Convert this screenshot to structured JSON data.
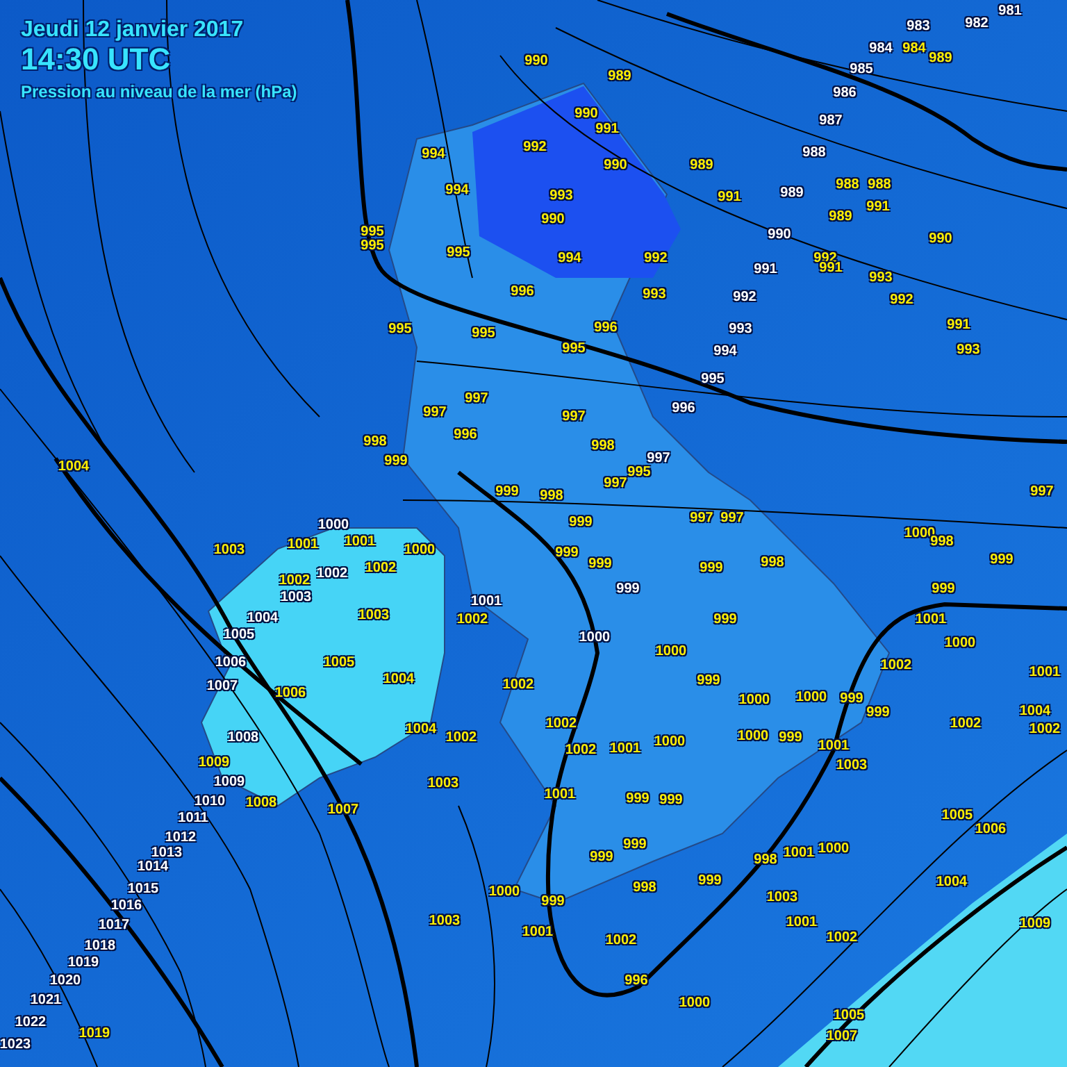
{
  "header": {
    "date": "Jeudi 12 janvier 2017",
    "time": "14:30 UTC",
    "subtitle": "Pression au niveau de la mer (hPa)"
  },
  "labels": [
    {
      "text": "1000",
      "kind": "isobar"
    },
    {
      "text": "1002",
      "kind": "isobar"
    },
    {
      "text": "1003",
      "kind": "isobar"
    },
    {
      "text": "1004",
      "kind": "isobar"
    },
    {
      "text": "1005",
      "kind": "isobar"
    },
    {
      "text": "1006",
      "kind": "isobar"
    },
    {
      "text": "1007",
      "kind": "isobar"
    },
    {
      "text": "1008",
      "kind": "isobar"
    },
    {
      "text": "1009",
      "kind": "isobar"
    },
    {
      "text": "1010",
      "kind": "isobar"
    },
    {
      "text": "1011",
      "kind": "isobar"
    },
    {
      "text": "1012",
      "kind": "isobar"
    },
    {
      "text": "1013",
      "kind": "isobar"
    },
    {
      "text": "1014",
      "kind": "isobar"
    },
    {
      "text": "1015",
      "kind": "isobar"
    },
    {
      "text": "1016",
      "kind": "isobar"
    },
    {
      "text": "1017",
      "kind": "isobar"
    },
    {
      "text": "1018",
      "kind": "isobar"
    },
    {
      "text": "1019",
      "kind": "isobar"
    },
    {
      "text": "1020",
      "kind": "isobar"
    },
    {
      "text": "1021",
      "kind": "isobar"
    },
    {
      "text": "1022",
      "kind": "isobar"
    },
    {
      "text": "1023",
      "kind": "isobar"
    },
    {
      "text": "981",
      "kind": "isobar"
    },
    {
      "text": "982",
      "kind": "isobar"
    },
    {
      "text": "983",
      "kind": "isobar"
    },
    {
      "text": "984",
      "kind": "isobar"
    },
    {
      "text": "985",
      "kind": "isobar"
    },
    {
      "text": "986",
      "kind": "isobar"
    },
    {
      "text": "987",
      "kind": "isobar"
    },
    {
      "text": "988",
      "kind": "isobar"
    },
    {
      "text": "989",
      "kind": "isobar"
    },
    {
      "text": "990",
      "kind": "isobar"
    },
    {
      "text": "991",
      "kind": "isobar"
    },
    {
      "text": "992",
      "kind": "isobar"
    },
    {
      "text": "993",
      "kind": "isobar"
    },
    {
      "text": "994",
      "kind": "isobar"
    },
    {
      "text": "995",
      "kind": "isobar"
    },
    {
      "text": "996",
      "kind": "isobar"
    },
    {
      "text": "997",
      "kind": "isobar"
    },
    {
      "text": "1001",
      "kind": "isobar"
    },
    {
      "text": "1000",
      "kind": "isobar"
    },
    {
      "text": "999",
      "kind": "isobar"
    },
    {
      "text": "990",
      "kind": "station"
    },
    {
      "text": "989",
      "kind": "station"
    },
    {
      "text": "990",
      "kind": "station"
    },
    {
      "text": "991",
      "kind": "station"
    },
    {
      "text": "992",
      "kind": "station"
    },
    {
      "text": "990",
      "kind": "station"
    },
    {
      "text": "994",
      "kind": "station"
    },
    {
      "text": "994",
      "kind": "station"
    },
    {
      "text": "993",
      "kind": "station"
    },
    {
      "text": "990",
      "kind": "station"
    },
    {
      "text": "994",
      "kind": "station"
    },
    {
      "text": "992",
      "kind": "station"
    },
    {
      "text": "996",
      "kind": "station"
    },
    {
      "text": "993",
      "kind": "station"
    },
    {
      "text": "995",
      "kind": "station"
    },
    {
      "text": "995",
      "kind": "station"
    },
    {
      "text": "995",
      "kind": "station"
    },
    {
      "text": "995",
      "kind": "station"
    },
    {
      "text": "995",
      "kind": "station"
    },
    {
      "text": "996",
      "kind": "station"
    },
    {
      "text": "995",
      "kind": "station"
    },
    {
      "text": "997",
      "kind": "station"
    },
    {
      "text": "997",
      "kind": "station"
    },
    {
      "text": "996",
      "kind": "station"
    },
    {
      "text": "997",
      "kind": "station"
    },
    {
      "text": "998",
      "kind": "station"
    },
    {
      "text": "998",
      "kind": "station"
    },
    {
      "text": "999",
      "kind": "station"
    },
    {
      "text": "989",
      "kind": "station"
    },
    {
      "text": "991",
      "kind": "station"
    },
    {
      "text": "988",
      "kind": "station"
    },
    {
      "text": "988",
      "kind": "station"
    },
    {
      "text": "991",
      "kind": "station"
    },
    {
      "text": "989",
      "kind": "station"
    },
    {
      "text": "992",
      "kind": "station"
    },
    {
      "text": "991",
      "kind": "station"
    },
    {
      "text": "993",
      "kind": "station"
    },
    {
      "text": "992",
      "kind": "station"
    },
    {
      "text": "993",
      "kind": "station"
    },
    {
      "text": "991",
      "kind": "station"
    },
    {
      "text": "990",
      "kind": "station"
    },
    {
      "text": "984",
      "kind": "station"
    },
    {
      "text": "989",
      "kind": "station"
    },
    {
      "text": "999",
      "kind": "station"
    },
    {
      "text": "998",
      "kind": "station"
    },
    {
      "text": "997",
      "kind": "station"
    },
    {
      "text": "995",
      "kind": "station"
    },
    {
      "text": "999",
      "kind": "station"
    },
    {
      "text": "999",
      "kind": "station"
    },
    {
      "text": "999",
      "kind": "station"
    },
    {
      "text": "997",
      "kind": "station"
    },
    {
      "text": "997",
      "kind": "station"
    },
    {
      "text": "999",
      "kind": "station"
    },
    {
      "text": "998",
      "kind": "station"
    },
    {
      "text": "999",
      "kind": "station"
    },
    {
      "text": "1000",
      "kind": "station"
    },
    {
      "text": "999",
      "kind": "station"
    },
    {
      "text": "1002",
      "kind": "station"
    },
    {
      "text": "1002",
      "kind": "station"
    },
    {
      "text": "1002",
      "kind": "station"
    },
    {
      "text": "1001",
      "kind": "station"
    },
    {
      "text": "1000",
      "kind": "station"
    },
    {
      "text": "1003",
      "kind": "station"
    },
    {
      "text": "1001",
      "kind": "station"
    },
    {
      "text": "1003",
      "kind": "station"
    },
    {
      "text": "1001",
      "kind": "station"
    },
    {
      "text": "1002",
      "kind": "station"
    },
    {
      "text": "1002",
      "kind": "station"
    },
    {
      "text": "1001",
      "kind": "station"
    },
    {
      "text": "1000",
      "kind": "station"
    },
    {
      "text": "1003",
      "kind": "station"
    },
    {
      "text": "1005",
      "kind": "station"
    },
    {
      "text": "1004",
      "kind": "station"
    },
    {
      "text": "1006",
      "kind": "station"
    },
    {
      "text": "1009",
      "kind": "station"
    },
    {
      "text": "1008",
      "kind": "station"
    },
    {
      "text": "1007",
      "kind": "station"
    },
    {
      "text": "1004",
      "kind": "station"
    },
    {
      "text": "1002",
      "kind": "station"
    },
    {
      "text": "1003",
      "kind": "station"
    },
    {
      "text": "1003",
      "kind": "station"
    },
    {
      "text": "1019",
      "kind": "station"
    },
    {
      "text": "1004",
      "kind": "station"
    },
    {
      "text": "1002",
      "kind": "station"
    },
    {
      "text": "1002",
      "kind": "station"
    },
    {
      "text": "1004",
      "kind": "station"
    },
    {
      "text": "1002",
      "kind": "station"
    },
    {
      "text": "1002",
      "kind": "station"
    },
    {
      "text": "1003",
      "kind": "station"
    },
    {
      "text": "1001",
      "kind": "station"
    },
    {
      "text": "1002",
      "kind": "station"
    },
    {
      "text": "1002",
      "kind": "station"
    },
    {
      "text": "996",
      "kind": "station"
    },
    {
      "text": "1000",
      "kind": "station"
    },
    {
      "text": "1005",
      "kind": "station"
    },
    {
      "text": "1006",
      "kind": "station"
    },
    {
      "text": "1004",
      "kind": "station"
    },
    {
      "text": "1009",
      "kind": "station"
    },
    {
      "text": "1005",
      "kind": "station"
    },
    {
      "text": "1007",
      "kind": "station"
    },
    {
      "text": "997",
      "kind": "station"
    },
    {
      "text": "1000",
      "kind": "station"
    },
    {
      "text": "998",
      "kind": "station"
    },
    {
      "text": "999",
      "kind": "station"
    },
    {
      "text": "999",
      "kind": "station"
    },
    {
      "text": "1001",
      "kind": "station"
    },
    {
      "text": "1000",
      "kind": "station"
    },
    {
      "text": "1001",
      "kind": "station"
    },
    {
      "text": "1000",
      "kind": "station"
    },
    {
      "text": "1000",
      "kind": "station"
    },
    {
      "text": "999",
      "kind": "station"
    },
    {
      "text": "999",
      "kind": "station"
    },
    {
      "text": "1000",
      "kind": "station"
    },
    {
      "text": "999",
      "kind": "station"
    },
    {
      "text": "1001",
      "kind": "station"
    },
    {
      "text": "999",
      "kind": "station"
    },
    {
      "text": "999",
      "kind": "station"
    },
    {
      "text": "999",
      "kind": "station"
    },
    {
      "text": "999",
      "kind": "station"
    },
    {
      "text": "998",
      "kind": "station"
    },
    {
      "text": "1001",
      "kind": "station"
    },
    {
      "text": "1000",
      "kind": "station"
    },
    {
      "text": "1000",
      "kind": "station"
    },
    {
      "text": "999",
      "kind": "station"
    },
    {
      "text": "998",
      "kind": "station"
    },
    {
      "text": "999",
      "kind": "station"
    },
    {
      "text": "1001",
      "kind": "station"
    }
  ]
}
